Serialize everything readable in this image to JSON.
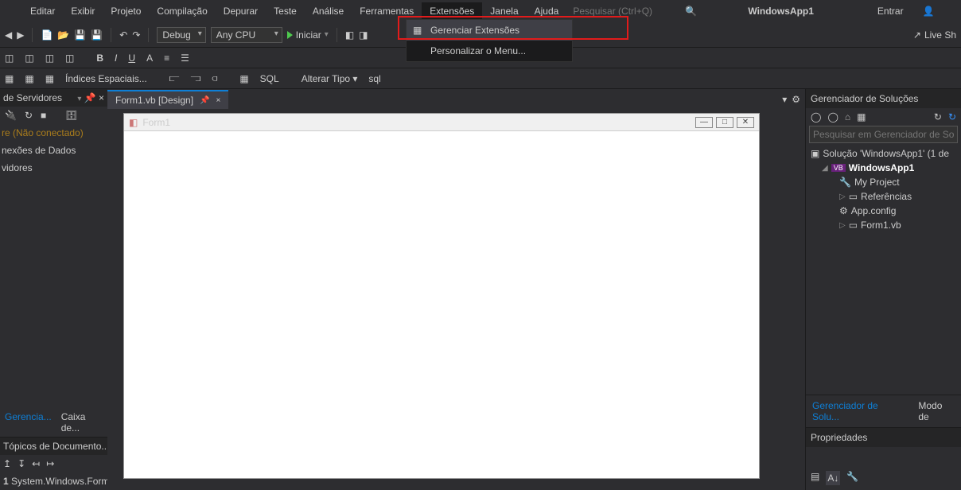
{
  "menu": {
    "items": [
      "Editar",
      "Exibir",
      "Projeto",
      "Compilação",
      "Depurar",
      "Teste",
      "Análise",
      "Ferramentas",
      "Extensões",
      "Janela",
      "Ajuda"
    ],
    "active": 8
  },
  "search": {
    "placeholder": "Pesquisar (Ctrl+Q)"
  },
  "app": {
    "name": "WindowsApp1",
    "signin": "Entrar",
    "liveshare": "Live Sh"
  },
  "dropdown": {
    "item1": "Gerenciar Extensões",
    "item2": "Personalizar o Menu..."
  },
  "toolbar": {
    "config": "Debug",
    "platform": "Any CPU",
    "start": "Iniciar",
    "spatial": "Índices Espaciais...",
    "changetype": "Alterar Tipo",
    "sql": "SQL"
  },
  "left": {
    "title": "de Servidores",
    "azure": "re (Não conectado)",
    "data": "nexões de Dados",
    "servers": "vidores",
    "tab1": "Gerencia...",
    "tab2": "Caixa de...",
    "outline_title": "Tópicos de Documento...",
    "outline_row_num": "1",
    "outline_row_text": "System.Windows.Form"
  },
  "doc": {
    "tab": "Form1.vb [Design]",
    "form_title": "Form1"
  },
  "solution": {
    "title": "Gerenciador de Soluções",
    "search": "Pesquisar em Gerenciador de Soluç",
    "root": "Solução 'WindowsApp1' (1 de",
    "proj": "WindowsApp1",
    "myproj": "My Project",
    "refs": "Referências",
    "appconfig": "App.config",
    "form": "Form1.vb",
    "tab_sol": "Gerenciador de Solu...",
    "tab_mode": "Modo de"
  },
  "props": {
    "title": "Propriedades"
  }
}
